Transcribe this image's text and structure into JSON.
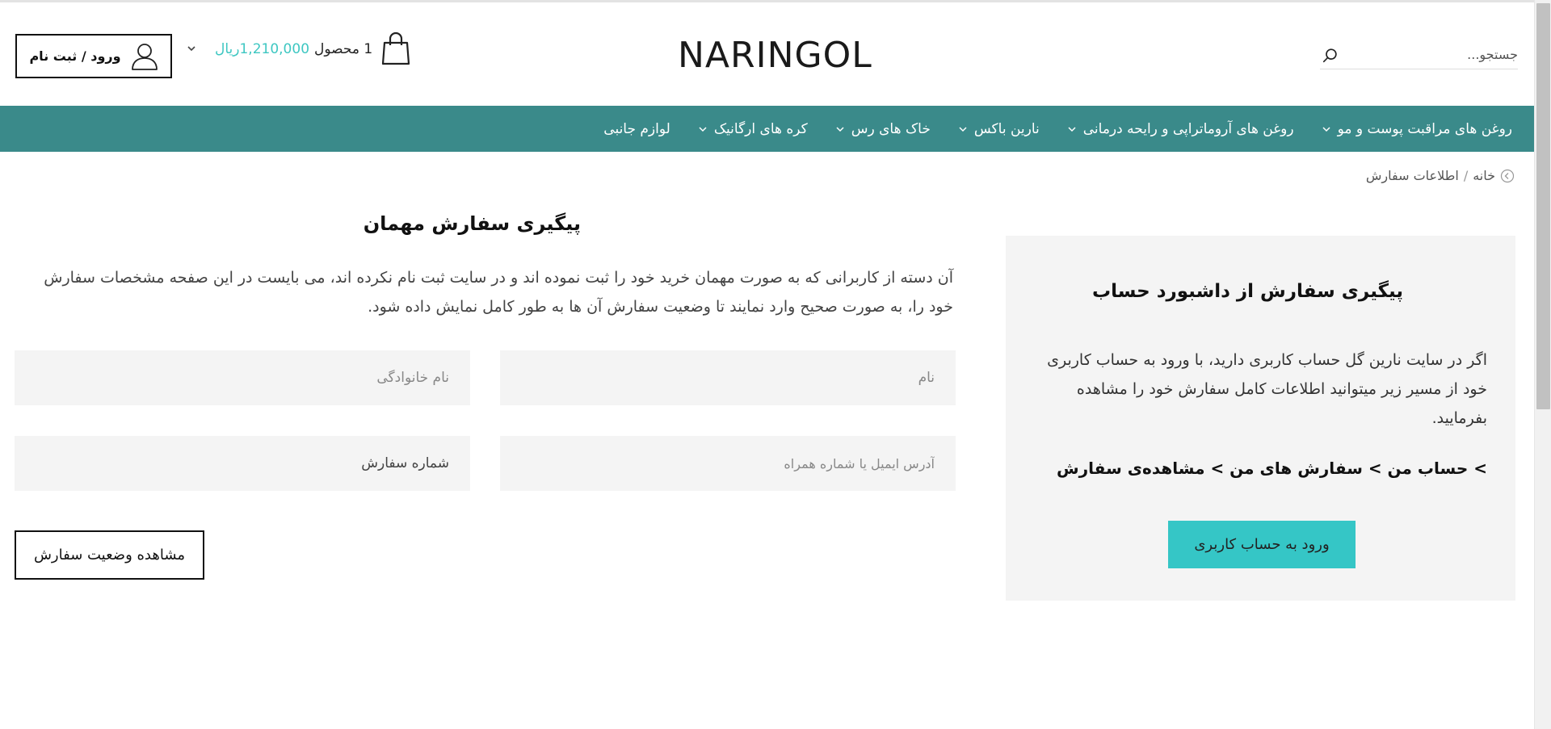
{
  "header": {
    "logo": "NARINGOL",
    "search": {
      "placeholder": "جستجو..."
    },
    "account_label": "ورود / ثبت نام",
    "cart": {
      "count": "1 محصول",
      "price": "1,210,000ریال"
    }
  },
  "nav": {
    "items": [
      {
        "label": "روغن های مراقبت پوست و مو",
        "has_dropdown": true
      },
      {
        "label": "روغن های آروماتراپی و رایحه درمانی",
        "has_dropdown": true
      },
      {
        "label": "نارین باکس",
        "has_dropdown": true
      },
      {
        "label": "خاک های رس",
        "has_dropdown": true
      },
      {
        "label": "کره های ارگانیک",
        "has_dropdown": true
      },
      {
        "label": "لوازم جانبی",
        "has_dropdown": false
      }
    ]
  },
  "breadcrumb": {
    "home": "خانه",
    "separator": "/",
    "current": "اطلاعات سفارش"
  },
  "dashboard_panel": {
    "title": "پیگیری سفارش از داشبورد حساب",
    "text": "اگر در سایت نارین گل حساب کاربری دارید، با ورود به حساب کاربری خود از مسیر زیر میتوانید اطلاعات کامل سفارش خود را مشاهده بفرمایید.",
    "path": "> حساب من > سفارش های من > مشاهده‌ی سفارش",
    "button": "ورود به حساب کاربری"
  },
  "guest_tracking": {
    "title": "پیگیری سفارش مهمان",
    "text": "آن دسته از کاربرانی که به صورت مهمان خرید خود را ثبت نموده اند و در سایت ثبت نام نکرده اند، می بایست در این صفحه مشخصات سفارش خود را، به صورت صحیح وارد نمایند تا وضعیت سفارش آن ها به طور کامل نمایش داده شود.",
    "fields": {
      "first_name": "نام",
      "last_name": "نام خانوادگی",
      "email_phone": "آدرس ایمیل یا شماره همراه",
      "order_number": "شماره سفارش"
    },
    "button": "مشاهده وضعیت سفارش"
  },
  "colors": {
    "nav_bg": "#3a8a8a",
    "accent": "#35c6c6",
    "price": "#3ec7c2",
    "panel_bg": "#f4f4f4"
  }
}
